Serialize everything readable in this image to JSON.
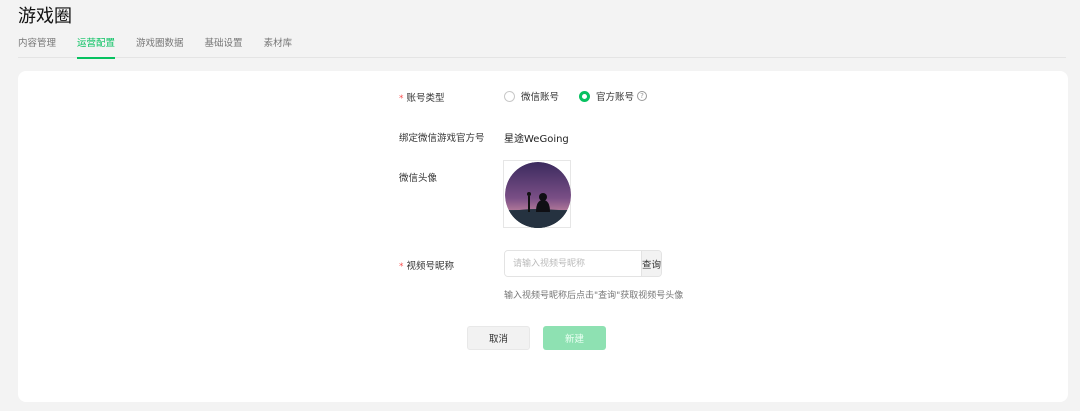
{
  "page": {
    "title": "游戏圈"
  },
  "tabs": [
    {
      "label": "内容管理"
    },
    {
      "label": "运营配置",
      "active": true
    },
    {
      "label": "游戏圈数据"
    },
    {
      "label": "基础设置"
    },
    {
      "label": "素材库"
    }
  ],
  "form": {
    "account_type": {
      "label": "账号类型",
      "required": "*",
      "options": [
        {
          "label": "微信账号",
          "checked": false
        },
        {
          "label": "官方账号",
          "checked": true
        }
      ],
      "help_glyph": "?"
    },
    "bound_account": {
      "label": "绑定微信游戏官方号",
      "value": "星途WeGoing"
    },
    "avatar": {
      "label": "微信头像"
    },
    "channel_nickname": {
      "label": "视频号昵称",
      "required": "*",
      "placeholder": "请输入视频号昵称",
      "value": "",
      "query_label": "查询",
      "hint": "输入视频号昵称后点击\"查询\"获取视频号头像"
    }
  },
  "actions": {
    "cancel_label": "取消",
    "create_label": "新建"
  },
  "colors": {
    "accent": "#07c160",
    "required": "#fa5151",
    "create_disabled": "#8ee1b2"
  }
}
